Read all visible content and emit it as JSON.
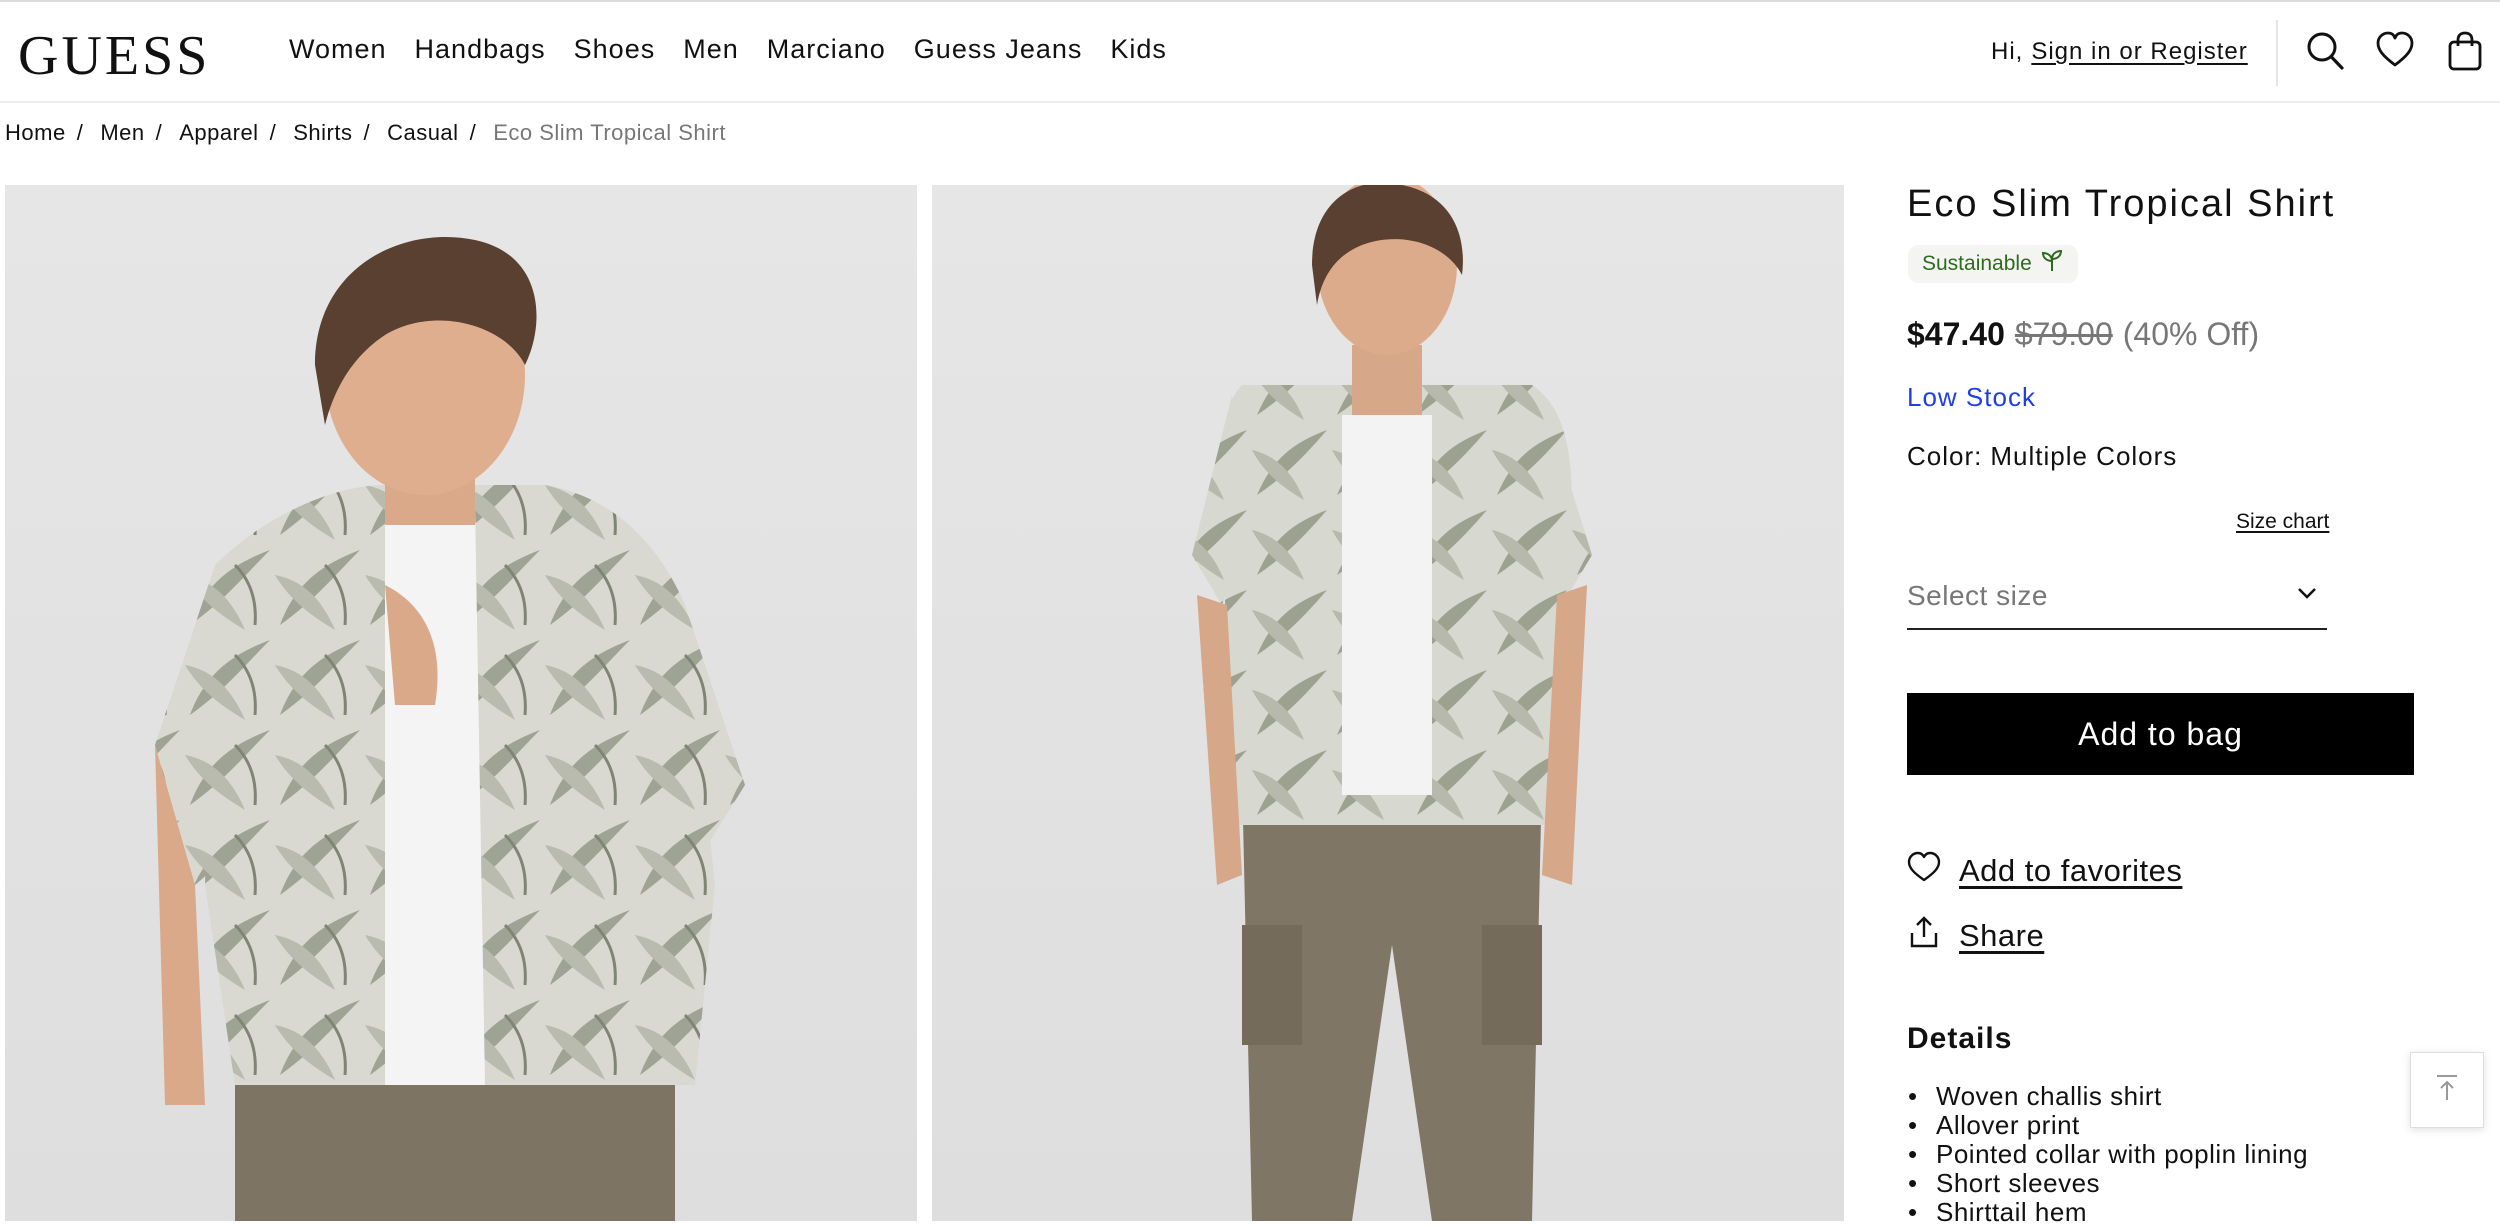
{
  "header": {
    "logo": "GUESS",
    "nav": [
      "Women",
      "Handbags",
      "Shoes",
      "Men",
      "Marciano",
      "Guess Jeans",
      "Kids"
    ],
    "greeting": "Hi,",
    "signin_link": "Sign in or Register",
    "icons": [
      "search-icon",
      "heart-icon",
      "bag-icon"
    ]
  },
  "breadcrumb": {
    "items": [
      "Home",
      "Men",
      "Apparel",
      "Shirts",
      "Casual"
    ],
    "current": "Eco Slim Tropical Shirt"
  },
  "product": {
    "title": "Eco Slim Tropical Shirt",
    "badge": "Sustainable",
    "price_now": "$47.40",
    "price_was": "$79.00",
    "discount": "(40% Off)",
    "stock": "Low Stock",
    "color_label": "Color:",
    "color_value": "Multiple Colors",
    "size_chart": "Size chart",
    "size_placeholder": "Select size",
    "add_to_bag": "Add to bag",
    "add_favorites": "Add to favorites",
    "share": "Share",
    "details_title": "Details",
    "details": [
      "Woven challis shirt",
      "Allover print",
      "Pointed collar with poplin lining",
      "Short sleeves",
      "Shirttail hem"
    ]
  },
  "colors": {
    "stock_blue": "#1f3fe0",
    "sustainable_green": "#2e6b1e",
    "button_black": "#000000"
  }
}
